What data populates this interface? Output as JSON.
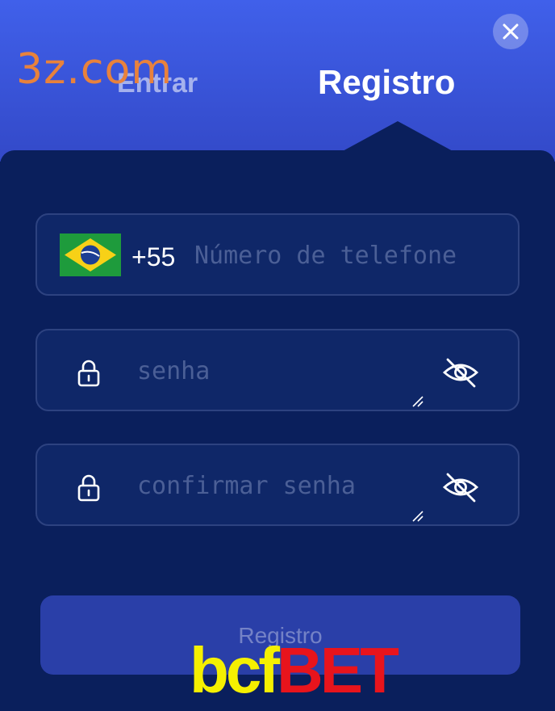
{
  "header": {
    "tabs": [
      {
        "label": "Entrar",
        "active": false
      },
      {
        "label": "Registro",
        "active": true
      }
    ],
    "close_icon": "close-icon"
  },
  "watermarks": {
    "top": "3z.com",
    "bottom_part1": "bcf",
    "bottom_part2": "BET"
  },
  "form": {
    "phone": {
      "country_flag": "brazil-flag-icon",
      "country_code": "+55",
      "placeholder": "Número de telefone",
      "value": ""
    },
    "password": {
      "placeholder": "senha",
      "value": "",
      "lock_icon": "lock-icon",
      "toggle_icon": "eye-off-icon"
    },
    "confirm_password": {
      "placeholder": "confirmar senha",
      "value": "",
      "lock_icon": "lock-icon",
      "toggle_icon": "eye-off-icon"
    },
    "submit_label": "Registro"
  },
  "colors": {
    "header_blue": "#4060ea",
    "panel_navy": "#0a1f5c",
    "field_bg": "#0f2768",
    "button_bg": "#2a3fa8",
    "watermark_orange": "#e8823c",
    "watermark_yellow": "#f5f000",
    "watermark_red": "#e8141c"
  }
}
